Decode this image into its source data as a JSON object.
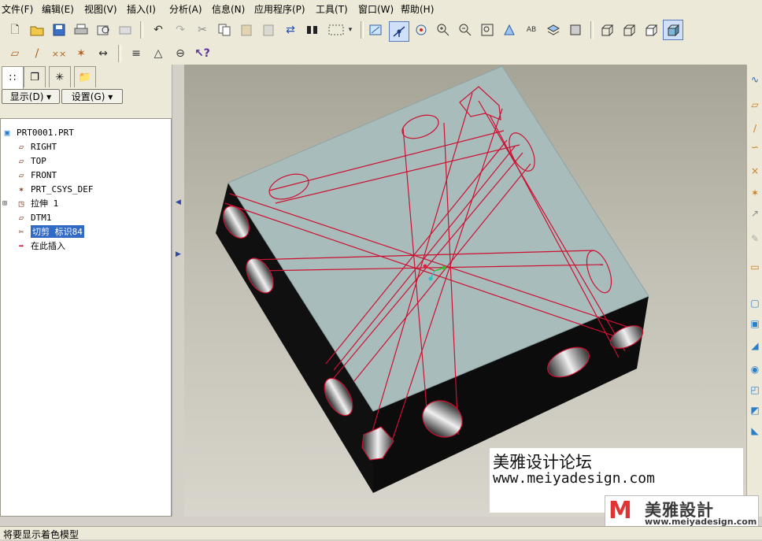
{
  "menu": [
    "文件(F)",
    "编辑(E)",
    "视图(V)",
    "插入(I)",
    "分析(A)",
    "信息(N)",
    "应用程序(P)",
    "工具(T)",
    "窗口(W)",
    "帮助(H)"
  ],
  "toolbar1_icons": [
    "new-file-icon",
    "open-folder-icon",
    "save-icon",
    "print-icon",
    "send-icon",
    "mail-icon",
    "undo-icon",
    "redo-icon",
    "cut-icon",
    "copy-icon",
    "paste-icon",
    "paste-special-icon",
    "regenerate-icon",
    "find-icon",
    "select-box-icon",
    "dropdown-icon",
    "datum-planes-icon",
    "spin-center-icon",
    "orient-icon",
    "zoom-in-icon",
    "zoom-out-icon",
    "refit-icon",
    "reorient-icon",
    "rename-icon",
    "layers-icon",
    "appearance-icon",
    "wireframe-icon",
    "hidden-line-icon",
    "no-hidden-icon",
    "shading-icon"
  ],
  "toolbar2_icons": [
    "datum-plane-display-icon",
    "datum-axis-display-icon",
    "datum-point-display-icon",
    "csys-display-icon",
    "dimension-icon",
    "sketch-plane-icon",
    "sketch-tools-icon",
    "measure-icon",
    "context-help-icon"
  ],
  "panel": {
    "tabs": [
      "model-tree-tab",
      "layers-tab",
      "favorites-tab",
      "folder-tab"
    ],
    "show_button": "显示(D) ▾",
    "settings_button": "设置(G) ▾",
    "tree": [
      {
        "label": "PRT0001.PRT",
        "icon": "part-icon",
        "indent": 0,
        "expander": false,
        "selected": false
      },
      {
        "label": "RIGHT",
        "icon": "datum-plane-icon",
        "indent": 1,
        "expander": false,
        "selected": false
      },
      {
        "label": "TOP",
        "icon": "datum-plane-icon",
        "indent": 1,
        "expander": false,
        "selected": false
      },
      {
        "label": "FRONT",
        "icon": "datum-plane-icon",
        "indent": 1,
        "expander": false,
        "selected": false
      },
      {
        "label": "PRT_CSYS_DEF",
        "icon": "csys-icon",
        "indent": 1,
        "expander": false,
        "selected": false
      },
      {
        "label": "拉伸 1",
        "icon": "extrude-icon",
        "indent": 1,
        "expander": true,
        "selected": false
      },
      {
        "label": "DTM1",
        "icon": "datum-plane-icon",
        "indent": 1,
        "expander": false,
        "selected": false
      },
      {
        "label": "切剪 标识84",
        "icon": "cut-icon",
        "indent": 1,
        "expander": false,
        "selected": true
      },
      {
        "label": "在此插入",
        "icon": "insert-here-arrow-icon",
        "indent": 1,
        "expander": false,
        "selected": false
      }
    ]
  },
  "watermark": {
    "title": "美雅设计论坛",
    "url": "www.meiyadesign.com"
  },
  "logo": {
    "mark": "M",
    "name": "美雅設計",
    "url": "www.meiyadesign.com"
  },
  "status": "将要显示着色模型",
  "colors": {
    "ui_face": "#ece9d8",
    "top_face": "#a9bcbc",
    "side_face": "#111111",
    "edge_red": "#cc1030",
    "selection": "#316ac5"
  }
}
